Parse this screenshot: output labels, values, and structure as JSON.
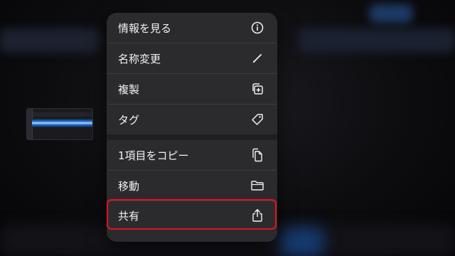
{
  "menu": {
    "items": [
      {
        "label": "情報を見る",
        "icon": "info-icon"
      },
      {
        "label": "名称変更",
        "icon": "pencil-icon"
      },
      {
        "label": "複製",
        "icon": "duplicate-icon"
      },
      {
        "label": "タグ",
        "icon": "tag-icon"
      },
      {
        "label": "1項目をコピー",
        "icon": "copy-document-icon"
      },
      {
        "label": "移動",
        "icon": "folder-icon"
      },
      {
        "label": "共有",
        "icon": "share-icon"
      }
    ]
  },
  "colors": {
    "menu_background": "#2b2b2e",
    "highlight_border": "#e0141e",
    "text": "#f2f2f4"
  }
}
